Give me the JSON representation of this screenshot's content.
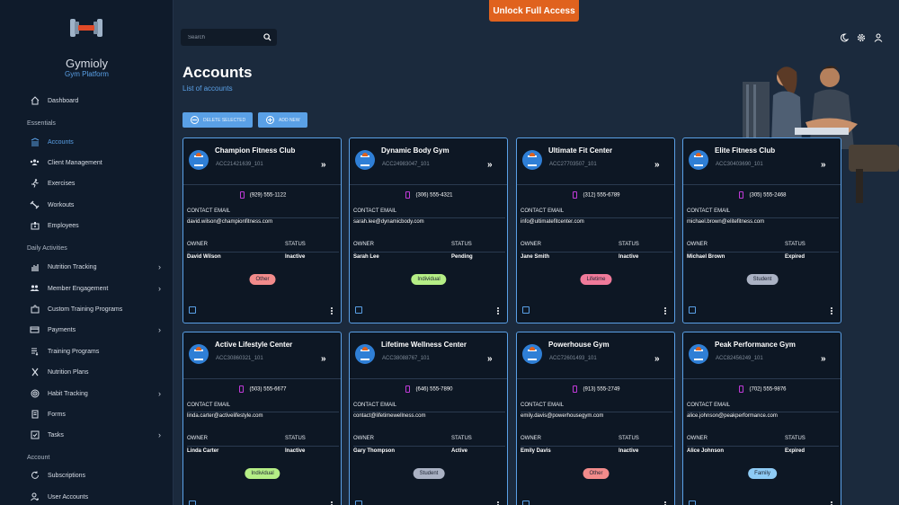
{
  "app": {
    "name": "Gymioly",
    "subtitle": "Gym Platform"
  },
  "topbar": {
    "search_placeholder": "Search",
    "unlock_label": "Unlock Full Access"
  },
  "sidebar": {
    "items_top": [
      {
        "label": "Dashboard",
        "icon": "home-icon"
      }
    ],
    "sections": [
      {
        "title": "Essentials",
        "items": [
          {
            "label": "Accounts",
            "icon": "building-icon",
            "active": true
          },
          {
            "label": "Client Management",
            "icon": "group-icon"
          },
          {
            "label": "Exercises",
            "icon": "runner-icon"
          },
          {
            "label": "Workouts",
            "icon": "dumbbell-icon"
          },
          {
            "label": "Employees",
            "icon": "badge-icon"
          }
        ]
      },
      {
        "title": "Daily Activities",
        "items": [
          {
            "label": "Nutrition Tracking",
            "icon": "chart-icon",
            "chevron": true
          },
          {
            "label": "Member Engagement",
            "icon": "people-icon",
            "chevron": true
          },
          {
            "label": "Custom Training Programs",
            "icon": "puzzle-icon"
          },
          {
            "label": "Payments",
            "icon": "card-icon",
            "chevron": true
          },
          {
            "label": "Training Programs",
            "icon": "list-icon"
          },
          {
            "label": "Nutrition Plans",
            "icon": "utensils-icon"
          },
          {
            "label": "Habit Tracking",
            "icon": "target-icon",
            "chevron": true
          },
          {
            "label": "Forms",
            "icon": "document-icon"
          },
          {
            "label": "Tasks",
            "icon": "checkbox-icon",
            "chevron": true
          }
        ]
      },
      {
        "title": "Account",
        "items": [
          {
            "label": "Subscriptions",
            "icon": "refresh-icon"
          },
          {
            "label": "User Accounts",
            "icon": "user-gear-icon"
          }
        ]
      }
    ]
  },
  "main": {
    "title": "Accounts",
    "subtitle": "List of accounts",
    "delete_label": "DELETE SELECTED",
    "add_label": "ADD NEW",
    "labels": {
      "contact_email": "CONTACT EMAIL",
      "owner": "OWNER",
      "status": "STATUS"
    },
    "cards": [
      {
        "name": "Champion Fitness Club",
        "account": "ACC21421639_101",
        "phone": "(929) 555-1122",
        "email": "david.wilson@championfitness.com",
        "owner": "David Wilson",
        "status": "Inactive",
        "badge": "Other",
        "badge_color": "#f28b8b"
      },
      {
        "name": "Dynamic Body Gym",
        "account": "ACC24983047_101",
        "phone": "(306) 555-4321",
        "email": "sarah.lee@dynamicbody.com",
        "owner": "Sarah Lee",
        "status": "Pending",
        "badge": "Individual",
        "badge_color": "#b5ee86"
      },
      {
        "name": "Ultimate Fit Center",
        "account": "ACC27703507_101",
        "phone": "(312) 555-6789",
        "email": "info@ultimatefitcenter.com",
        "owner": "Jane Smith",
        "status": "Inactive",
        "badge": "Lifetime",
        "badge_color": "#f07a9a"
      },
      {
        "name": "Elite Fitness Club",
        "account": "ACC30403690_101",
        "phone": "(305) 555-2468",
        "email": "michael.brown@elitefitness.com",
        "owner": "Michael Brown",
        "status": "Expired",
        "badge": "Student",
        "badge_color": "#aab2c4"
      },
      {
        "name": "Active Lifestyle Center",
        "account": "ACC30860321_101",
        "phone": "(503) 555-6677",
        "email": "linda.carter@activelifestyle.com",
        "owner": "Linda Carter",
        "status": "Inactive",
        "badge": "Individual",
        "badge_color": "#b5ee86"
      },
      {
        "name": "Lifetime Wellness Center",
        "account": "ACC38088767_101",
        "phone": "(646) 555-7890",
        "email": "contact@lifetimewellness.com",
        "owner": "Gary Thompson",
        "status": "Active",
        "badge": "Student",
        "badge_color": "#aab2c4"
      },
      {
        "name": "Powerhouse Gym",
        "account": "ACC72601493_101",
        "phone": "(913) 555-2749",
        "email": "emily.davis@powerhousegym.com",
        "owner": "Emily Davis",
        "status": "Inactive",
        "badge": "Other",
        "badge_color": "#f28b8b"
      },
      {
        "name": "Peak Performance Gym",
        "account": "ACC82456249_101",
        "phone": "(702) 555-9876",
        "email": "alice.johnson@peakperformance.com",
        "owner": "Alice Johnson",
        "status": "Expired",
        "badge": "Family",
        "badge_color": "#8ecbf5"
      }
    ]
  },
  "colors": {
    "accent": "#5aa0e6",
    "unlock": "#e0621e",
    "sidebar_bg": "#0f1b2b",
    "main_bg": "#1b2a3d",
    "card_bg": "#0d1724"
  }
}
